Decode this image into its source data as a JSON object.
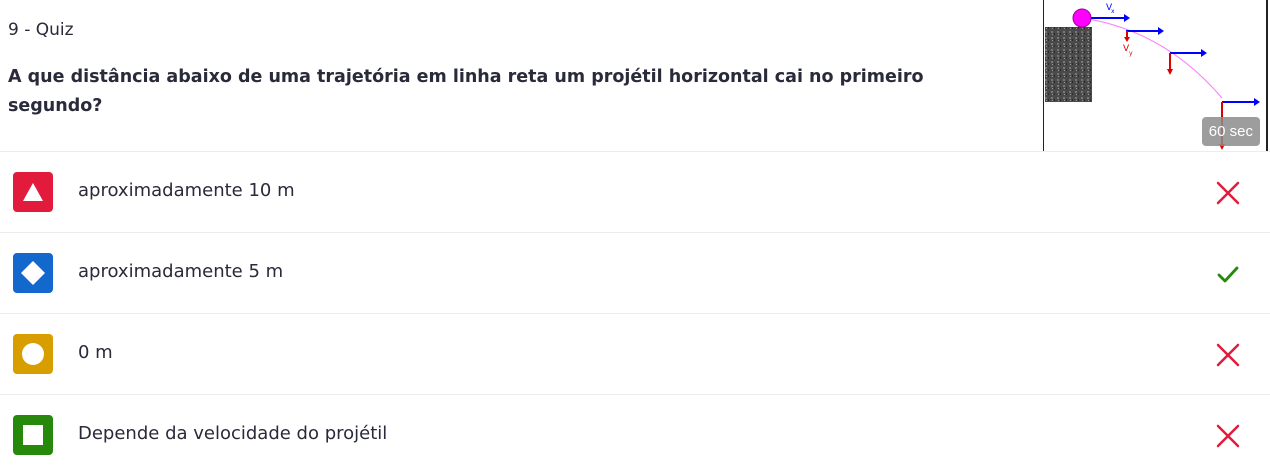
{
  "quiz": {
    "label": "9 - Quiz",
    "question": "A que distância abaixo de uma trajetória em linha reta um projétil horizontal cai no primeiro segundo?",
    "timer": "60 sec",
    "media": {
      "vx_label": "V",
      "vx_sub": "x",
      "vy_label": "V",
      "vy_sub": "y"
    }
  },
  "options": [
    {
      "text": "aproximadamente 10 m",
      "shape": "triangle-icon",
      "color": "#e21b3c",
      "correct": false
    },
    {
      "text": "aproximadamente 5 m",
      "shape": "diamond-icon",
      "color": "#1368ce",
      "correct": true
    },
    {
      "text": "0 m",
      "shape": "circle-icon",
      "color": "#d89e00",
      "correct": false
    },
    {
      "text": "Depende da velocidade do projétil",
      "shape": "square-icon",
      "color": "#26890c",
      "correct": false
    }
  ],
  "colors": {
    "wrong": "#e21b3c",
    "correct": "#26890c"
  }
}
